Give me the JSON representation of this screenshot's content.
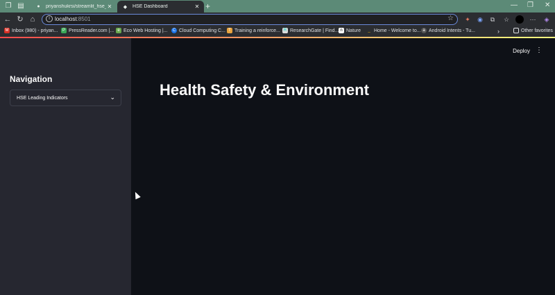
{
  "browser": {
    "tabs": [
      {
        "title": "priyanshukrsi/streamlit_hse_dashb",
        "active": false
      },
      {
        "title": "HSE Dashboard",
        "active": true
      }
    ],
    "address": {
      "host": "localhost",
      "port": ":8501"
    },
    "bookmarks": [
      {
        "label": "Inbox (980) - priyan...",
        "icon": "gmail-icon"
      },
      {
        "label": "PressReader.com |...",
        "icon": "pressreader-icon"
      },
      {
        "label": "Eco Web Hosting |...",
        "icon": "eco-icon"
      },
      {
        "label": "Cloud Computing C...",
        "icon": "cloud-icon"
      },
      {
        "label": "Training a reinforce...",
        "icon": "training-icon"
      },
      {
        "label": "ResearchGate | Find...",
        "icon": "researchgate-icon"
      },
      {
        "label": "Nature",
        "icon": "nature-icon"
      },
      {
        "label": "Home - Welcome to...",
        "icon": "home-icon"
      },
      {
        "label": "Android Intents - Tu...",
        "icon": "android-icon"
      }
    ],
    "other_favorites": "Other favorites"
  },
  "sidebar": {
    "title": "Navigation",
    "select_value": "HSE Leading Indicators"
  },
  "header": {
    "deploy": "Deploy"
  },
  "main": {
    "title": "Health Safety & Environment"
  },
  "colors": {
    "sidebar_bg": "#262730",
    "main_bg": "#0e1117",
    "tabbar_bg": "#5c8a77",
    "accent_start": "#ff4b4b",
    "accent_end": "#fffd80"
  }
}
